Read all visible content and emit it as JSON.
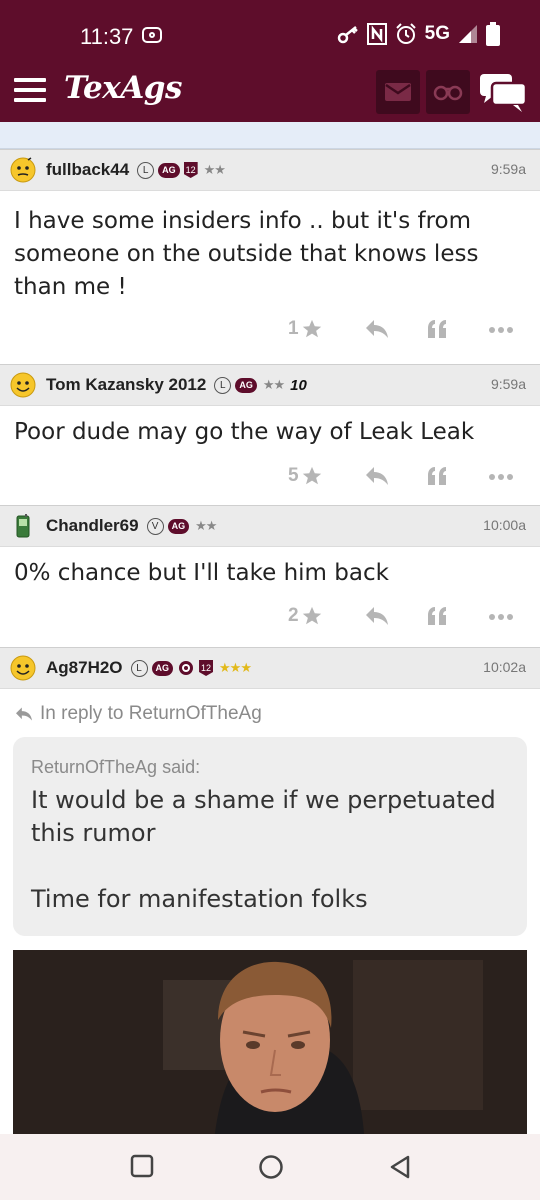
{
  "status_bar": {
    "time": "11:37",
    "network": "5G"
  },
  "nav": {
    "logo": "TexAgs"
  },
  "posts": [
    {
      "username": "fullback44",
      "badges": [
        "L",
        "AG",
        "12"
      ],
      "time": "9:59a",
      "body": "I have some insiders info .. but it's from someone on the outside that knows less than me !",
      "likes": "1"
    },
    {
      "username": "Tom Kazansky 2012",
      "badges": [
        "L",
        "AG"
      ],
      "tag": "10",
      "time": "9:59a",
      "body": "Poor dude may go the way of Leak Leak",
      "likes": "5"
    },
    {
      "username": "Chandler69",
      "badges": [
        "V",
        "AG"
      ],
      "time": "10:00a",
      "body": "0% chance but I'll take him back",
      "likes": "2"
    },
    {
      "username": "Ag87H2O",
      "badges": [
        "L",
        "AG",
        "12"
      ],
      "time": "10:02a",
      "reply_to": "In reply to ReturnOfTheAg",
      "quote_author": "ReturnOfTheAg said:",
      "quote_text": "It would be a shame if we perpetuated this rumor\n\nTime for manifestation folks"
    }
  ],
  "colors": {
    "brand": "#5e0d2b",
    "gold_star": "#e2b91a"
  }
}
